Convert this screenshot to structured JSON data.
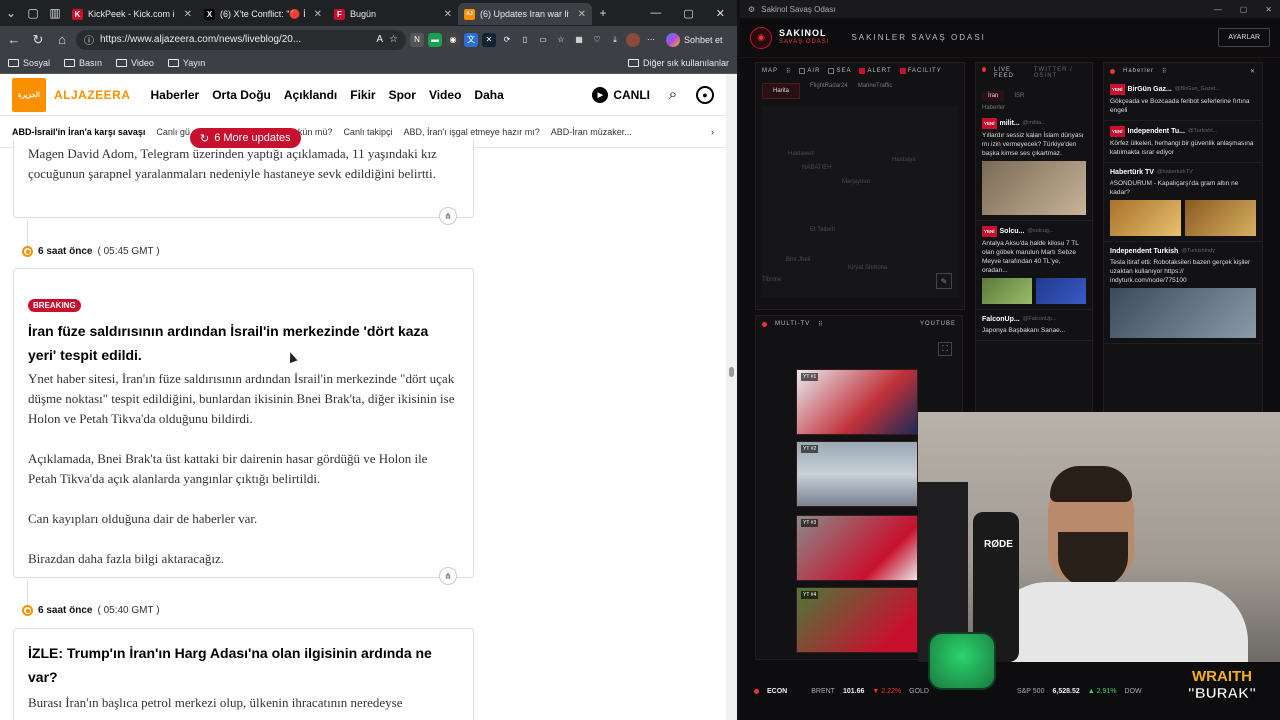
{
  "browser": {
    "tabs": [
      {
        "title": "KickPeek - Kick.com için Ge",
        "favicon": "K",
        "color": "#c8102e",
        "active": false
      },
      {
        "title": "(6) X'te Conflict: \"🔴 İran'ı",
        "favicon": "X",
        "color": "#000000",
        "active": false
      },
      {
        "title": "Bugün",
        "favicon": "F",
        "color": "#c8102e",
        "active": false
      },
      {
        "title": "(6) Updates Iran war live: Tr",
        "favicon": "AJ",
        "color": "#fa9000",
        "active": true
      }
    ],
    "url": "https://www.aljazeera.com/news/liveblog/20...",
    "sohbet_label": "Sohbet et",
    "bookmarks": [
      "Sosyal",
      "Basın",
      "Video",
      "Yayın"
    ],
    "bookmarks_right": "Diğer sık kullanılanlar"
  },
  "site": {
    "logo_glyph": "الجزيرة",
    "brand": "ALJAZEERA",
    "nav": [
      "Haberler",
      "Orta Doğu",
      "Açıklandı",
      "Fikir",
      "Spor",
      "Video",
      "Daha"
    ],
    "canli": "CANLI",
    "topics": [
      "ABD-İsrail'in İran'a karşı savaşı",
      "Canlı gü...",
      "...seçil bir çözüm mümkün mü?",
      "Canlı takipçi",
      "ABD, İran'ı işgal etmeye hazır mı?",
      "ABD-İran müzaker..."
    ],
    "more_updates": "6 More updates"
  },
  "posts": {
    "p0": {
      "body": "Magen David Adom, Telegram üzerinden yaptığı açıklamada, 11 yaşındaki kız çocuğunun şarapnel yaralanmaları nedeniyle hastaneye sevk edildiğini belirtti."
    },
    "p1": {
      "time_rel": "6 saat önce",
      "time_gmt": "( 05:45 GMT )",
      "badge": "BREAKING",
      "headline": "İran füze saldırısının ardından İsrail'in merkezinde 'dört kaza yeri' tespit edildi.",
      "para1": "Ynet haber sitesi, İran'ın füze saldırısının ardından İsrail'in merkezinde \"dört uçak düşme noktası\" tespit edildiğini, bunlardan ikisinin Bnei Brak'ta, diğer ikisinin ise Holon ve Petah Tikva'da olduğunu bildirdi.",
      "para2": "Açıklamada, Bnei Brak'ta üst kattaki bir dairenin hasar gördüğü ve Holon ile Petah Tikva'da açık alanlarda yangınlar çıktığı belirtildi.",
      "para3": "Can kayıpları olduğuna dair de haberler var.",
      "para4": "Birazdan daha fazla bilgi aktaracağız."
    },
    "p2": {
      "time_rel": "6 saat önce",
      "time_gmt": "( 05:40 GMT )",
      "headline": "İZLE: Trump'ın İran'ın Harg Adası'na olan ilgisinin ardında ne var?",
      "para1": "Burası İran'ın başlıca petrol merkezi olup, ülkenin ihracatının neredeyse"
    }
  },
  "dash": {
    "window_title": "Sakinol Savaş Odası",
    "brand_a": "SAKINOL",
    "brand_b": "SAVAŞ ODASI",
    "subtitle": "SAKINLER SAVAŞ ODASI",
    "settings": "AYARLAR",
    "map": {
      "label": "MAP",
      "filters": [
        {
          "name": "AIR",
          "on": false
        },
        {
          "name": "SEA",
          "on": false
        },
        {
          "name": "ALERT",
          "on": true
        },
        {
          "name": "FACILITY",
          "on": true
        }
      ],
      "tabs": [
        "Harita",
        "FlightRadar24",
        "MarineTraffic"
      ],
      "places": [
        "Haldaweh",
        "NABATIEH",
        "Marjayoun",
        "Hasbaya",
        "Et Taibeh",
        "Bint Jbeil",
        "Kiryat Shmona",
        "Tibnine"
      ]
    },
    "livefeed": {
      "label": "LIVE FEED",
      "sub": "TWITTER / OSINT",
      "tabs": [
        "İran",
        "İSR"
      ],
      "subtab": "Haberler",
      "items": [
        {
          "src": "milit...",
          "handle": "@militа...",
          "text": "Yıllardır sessiz kalan İslam dünyası mı izin vermeyecek? Türkiye'den başka kimse ses çıkartmaz."
        },
        {
          "src": "Solcu...",
          "handle": "@solcug...",
          "text": "Antalya Aksu'da halde kilosu 7 TL olan göbek marulun Martı Sebze Meyve tarafından 40 TL'ye, oradan..."
        },
        {
          "src": "FalconUp...",
          "handle": "@FalconUp...",
          "text": "Japonya Başbakanı Sanae..."
        }
      ]
    },
    "haberler": {
      "label": "Haberler",
      "items": [
        {
          "src": "BirGün Gaz...",
          "handle": "@BirGun_Gazet...",
          "text": "Gökçeada ve Bozcaada feribot seferlerine fırtına engeli"
        },
        {
          "src": "Independent Tu...",
          "handle": "@Turkishl...",
          "text": "Körfez ülkeleri, herhangi bir güvenlik anlaşmasına katılmakta ısrar ediyor"
        },
        {
          "src": "Habertürk TV",
          "handle": "@haberturkTV",
          "text": "#SONDURUM - Kapalıçarşı'da gram altın ne kadar?"
        },
        {
          "src": "Independent Turkish",
          "handle": "@Turkishlndy",
          "text": "Tesla itiraf etti: Robotaksileri bazen gerçek kişiler uzaktan kullanıyor https:// indyturk.com/node/775100"
        }
      ],
      "new_tag": "YENİ"
    },
    "multitv": {
      "label": "MULTI-TV",
      "source": "YOUTUBE",
      "channels": [
        "YT #1",
        "YT #2",
        "YT #3",
        "YT #4"
      ]
    },
    "ticker": {
      "label": "ECON",
      "items": [
        {
          "name": "BRENT",
          "value": "101.66",
          "change": "▼ 2.22%",
          "dir": "down"
        },
        {
          "name": "GOLD",
          "value": "",
          "change": "",
          "dir": "up"
        },
        {
          "name": "S&P 500",
          "value": "6,528.52",
          "change": "▲ 2.91%",
          "dir": "up"
        },
        {
          "name": "DOW",
          "value": "",
          "change": "",
          "dir": "up"
        }
      ]
    },
    "overlay": {
      "line1": "WRAITH",
      "line2": "\"BURAK\""
    }
  }
}
